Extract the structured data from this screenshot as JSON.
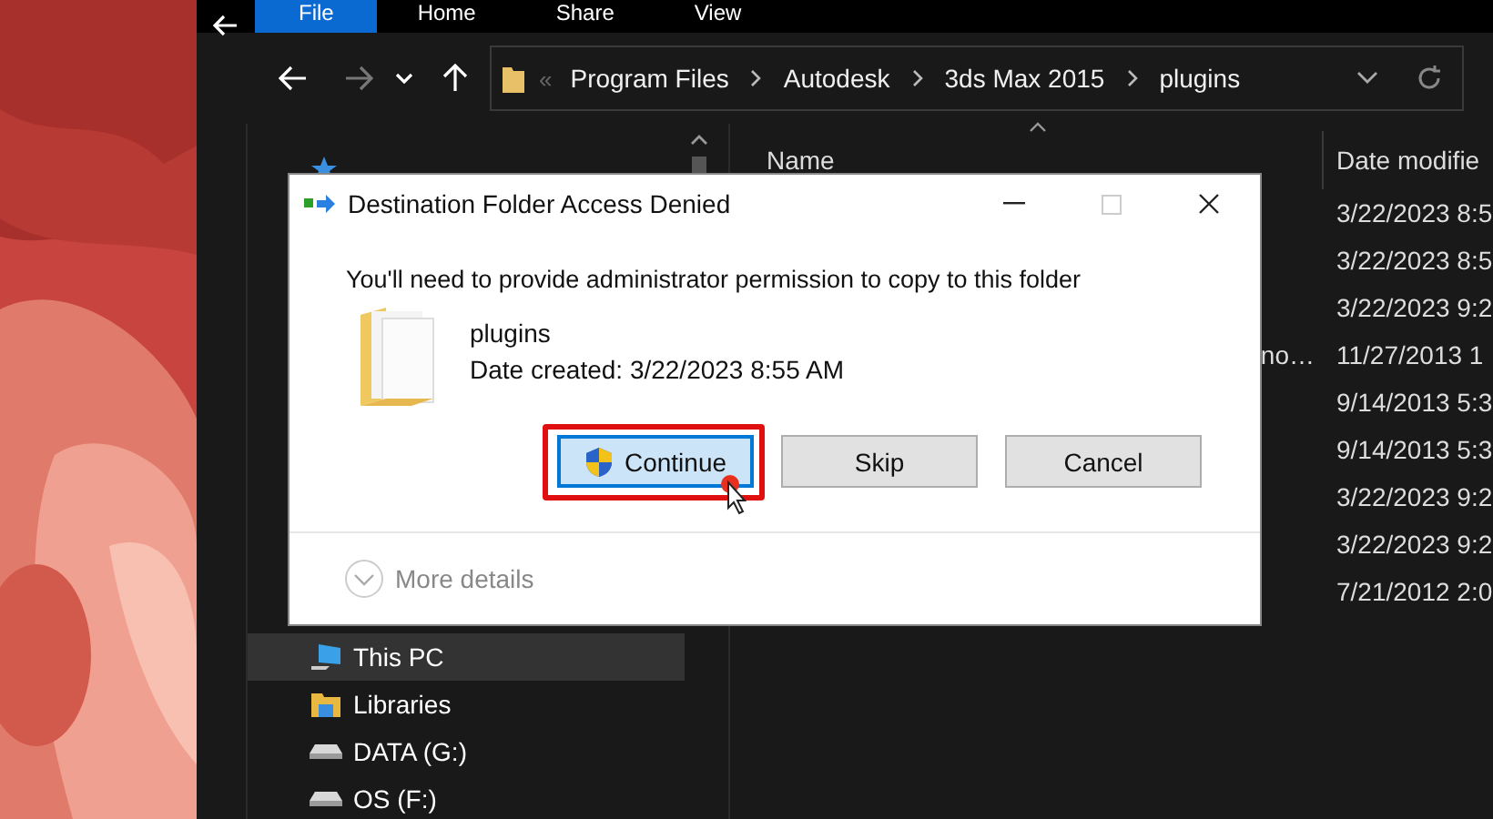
{
  "ribbon": {
    "tabs": [
      {
        "label": "File",
        "selected": true
      },
      {
        "label": "Home",
        "selected": false
      },
      {
        "label": "Share",
        "selected": false
      },
      {
        "label": "View",
        "selected": false
      }
    ]
  },
  "address_bar": {
    "overflow": "«",
    "path": [
      "Program Files",
      "Autodesk",
      "3ds Max 2015",
      "plugins"
    ]
  },
  "sidebar": {
    "pinned": {
      "kind": "star",
      "selected": false
    },
    "items": [
      {
        "label": "This PC",
        "kind": "pc",
        "selected": true
      },
      {
        "label": "Libraries",
        "kind": "library",
        "selected": false
      },
      {
        "label": "DATA (G:)",
        "kind": "drive",
        "selected": false
      },
      {
        "label": "OS (F:)",
        "kind": "drive",
        "selected": false
      }
    ]
  },
  "file_list": {
    "columns": [
      "Name",
      "Date modifie"
    ],
    "rows": [
      {
        "date": "3/22/2023 8:5"
      },
      {
        "date": "3/22/2023 8:5"
      },
      {
        "date": "3/22/2023 9:2"
      },
      {
        "name": "no…",
        "date": "11/27/2013 1"
      },
      {
        "date": "9/14/2013 5:3"
      },
      {
        "date": "9/14/2013 5:3"
      },
      {
        "date": "3/22/2023 9:2"
      },
      {
        "date": "3/22/2023 9:2"
      },
      {
        "date": "7/21/2012 2:0"
      }
    ]
  },
  "dialog": {
    "title": "Destination Folder Access Denied",
    "message": "You'll need to provide administrator permission to copy to this folder",
    "item": {
      "name": "plugins",
      "detail": "Date created: 3/22/2023 8:55 AM"
    },
    "buttons": [
      {
        "label": "Continue",
        "kind": "shield",
        "focused": true,
        "highlighted": true
      },
      {
        "label": "Skip",
        "kind": "plain",
        "focused": false,
        "highlighted": false
      },
      {
        "label": "Cancel",
        "kind": "plain",
        "focused": false,
        "highlighted": false
      }
    ],
    "details": "More details"
  }
}
